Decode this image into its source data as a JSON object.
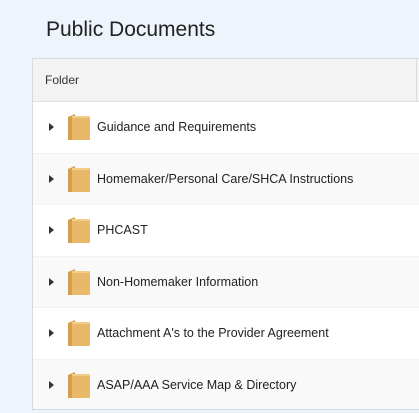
{
  "page": {
    "title": "Public Documents"
  },
  "table": {
    "column_header": "Folder",
    "rows": [
      {
        "label": "Guidance and Requirements",
        "icon": "folder-icon"
      },
      {
        "label": "Homemaker/Personal Care/SHCA Instructions",
        "icon": "folder-icon"
      },
      {
        "label": "PHCAST",
        "icon": "folder-icon"
      },
      {
        "label": "Non-Homemaker Information",
        "icon": "folder-icon"
      },
      {
        "label": "Attachment A's to the Provider Agreement",
        "icon": "folder-icon"
      },
      {
        "label": "ASAP/AAA Service Map & Directory",
        "icon": "folder-icon"
      }
    ]
  },
  "colors": {
    "page_background": "#eef4fb",
    "folder_front": "#e8b96a",
    "folder_back": "#d79f4a",
    "header_background": "#f3f3f3"
  }
}
